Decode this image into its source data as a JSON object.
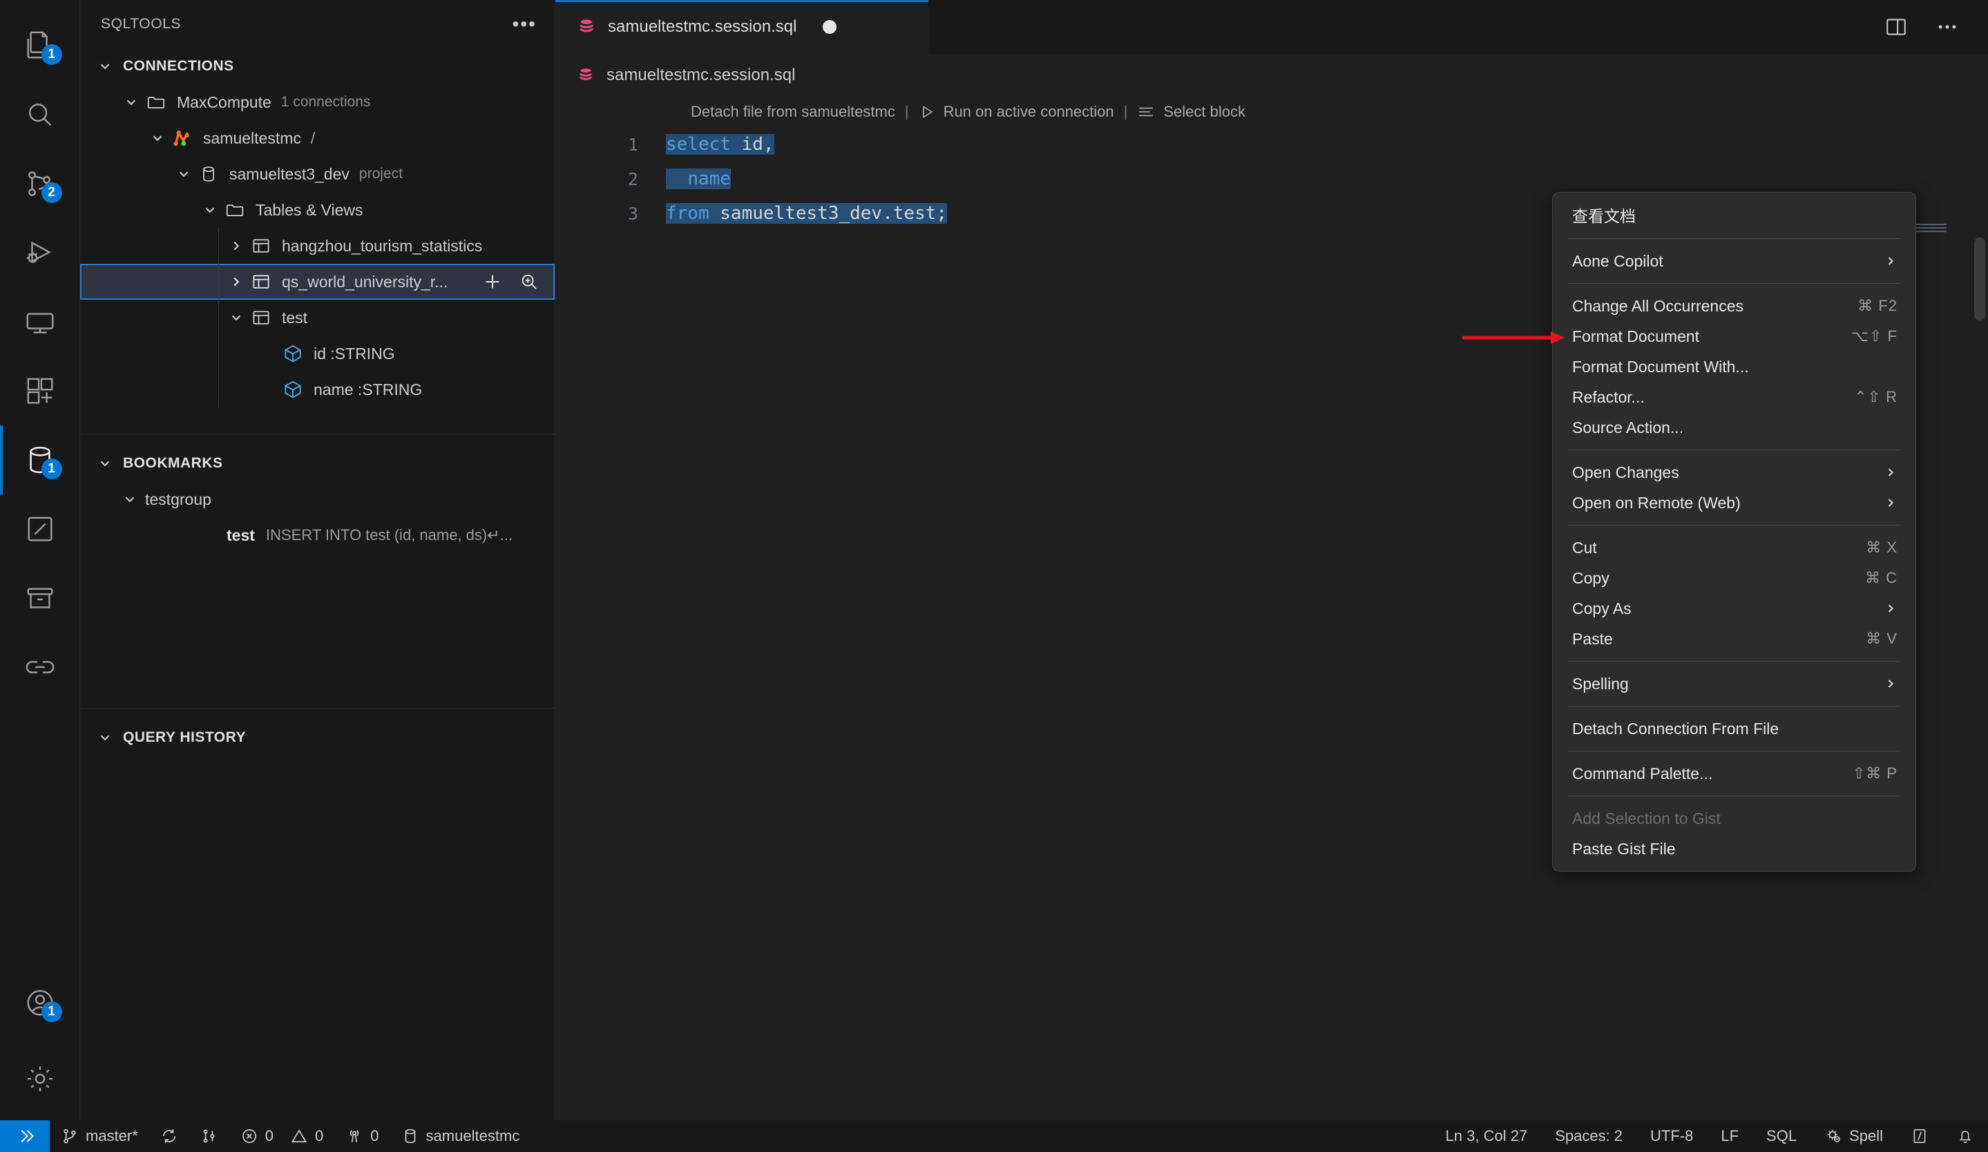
{
  "activitybar": {
    "items": [
      {
        "name": "explorer",
        "icon": "files-icon",
        "badge": "1",
        "active": false
      },
      {
        "name": "search",
        "icon": "search-icon",
        "badge": "",
        "active": false
      },
      {
        "name": "source-control",
        "icon": "source-control-icon",
        "badge": "2",
        "active": false
      },
      {
        "name": "run-and-debug",
        "icon": "run-debug-icon",
        "badge": "",
        "active": false
      },
      {
        "name": "remote-explorer",
        "icon": "remote-explorer-icon",
        "badge": "",
        "active": false
      },
      {
        "name": "extensions",
        "icon": "extensions-icon",
        "badge": "",
        "active": false
      },
      {
        "name": "sqltools",
        "icon": "database-icon",
        "badge": "1",
        "active": true
      },
      {
        "name": "todo",
        "icon": "pencil-icon",
        "badge": "",
        "active": false
      },
      {
        "name": "archive",
        "icon": "archive-icon",
        "badge": "",
        "active": false
      },
      {
        "name": "link",
        "icon": "link-icon",
        "badge": "",
        "active": false
      }
    ],
    "bottom": [
      {
        "name": "accounts",
        "icon": "account-icon",
        "badge": "1"
      },
      {
        "name": "manage-settings",
        "icon": "gear-icon",
        "badge": ""
      }
    ]
  },
  "sidebar": {
    "title": "SQLTOOLS",
    "more_actions": "•••",
    "sections": [
      {
        "name": "connections",
        "label": "CONNECTIONS",
        "expanded": true
      },
      {
        "name": "bookmarks",
        "label": "BOOKMARKS",
        "expanded": true
      },
      {
        "name": "query-history",
        "label": "QUERY HISTORY",
        "expanded": true
      }
    ],
    "connections_tree": [
      {
        "label": "MaxCompute",
        "sub": "1 connections",
        "icon": "folder-icon",
        "depth": 1,
        "twisty": "down",
        "selected": false
      },
      {
        "label": "samueltestmc",
        "slash": "/",
        "icon": "connection-active-icon",
        "depth": 2,
        "twisty": "down",
        "selected": false
      },
      {
        "label": "samueltest3_dev",
        "sub": "project",
        "icon": "database-icon",
        "depth": 3,
        "twisty": "down",
        "selected": false
      },
      {
        "label": "Tables & Views",
        "icon": "folder-icon",
        "depth": 4,
        "twisty": "down",
        "selected": false
      },
      {
        "label": "hangzhou_tourism_statistics",
        "icon": "table-icon",
        "depth": 5,
        "twisty": "right",
        "selected": false
      },
      {
        "label": "qs_world_university_r...",
        "icon": "table-icon",
        "depth": 5,
        "twisty": "right",
        "selected": true,
        "actions": [
          "add-icon",
          "zoom-in-icon"
        ]
      },
      {
        "label": "test",
        "icon": "table-icon",
        "depth": 5,
        "twisty": "down",
        "selected": false
      },
      {
        "label": "id :STRING",
        "icon": "column-icon",
        "depth": 6,
        "twisty": "none",
        "selected": false
      },
      {
        "label": "name :STRING",
        "icon": "column-icon",
        "depth": 6,
        "twisty": "none",
        "selected": false
      }
    ],
    "bookmarks_tree": [
      {
        "label": "testgroup",
        "depth": 1,
        "twisty": "down"
      }
    ],
    "bookmark_item": {
      "name": "test",
      "desc": "INSERT INTO test (id, name, ds)↵..."
    }
  },
  "editor": {
    "tab": {
      "label": "samueltestmc.session.sql",
      "icon": "sql-file-icon",
      "dirty": true
    },
    "tab_actions": [
      "split-editor-icon",
      "more-actions-icon"
    ],
    "breadcrumb": {
      "icon": "sql-file-icon",
      "label": "samueltestmc.session.sql"
    },
    "codelens": {
      "detach": "Detach file from samueltestmc",
      "separator": "|",
      "run": "Run on active connection",
      "select_block": "Select block"
    },
    "lines": [
      {
        "num": "1",
        "text": "select id,"
      },
      {
        "num": "2",
        "text": "  name"
      },
      {
        "num": "3",
        "text": "from samueltest3_dev.test;"
      }
    ]
  },
  "context_menu": {
    "groups": [
      [
        {
          "label": "查看文档",
          "key": "",
          "submenu": false,
          "disabled": false
        }
      ],
      [
        {
          "label": "Aone Copilot",
          "key": "",
          "submenu": true,
          "disabled": false
        }
      ],
      [
        {
          "label": "Change All Occurrences",
          "key": "⌘ F2",
          "submenu": false,
          "disabled": false
        },
        {
          "label": "Format Document",
          "key": "⌥⇧ F",
          "submenu": false,
          "disabled": false
        },
        {
          "label": "Format Document With...",
          "key": "",
          "submenu": false,
          "disabled": false
        },
        {
          "label": "Refactor...",
          "key": "⌃⇧ R",
          "submenu": false,
          "disabled": false
        },
        {
          "label": "Source Action...",
          "key": "",
          "submenu": false,
          "disabled": false
        }
      ],
      [
        {
          "label": "Open Changes",
          "key": "",
          "submenu": true,
          "disabled": false
        },
        {
          "label": "Open on Remote (Web)",
          "key": "",
          "submenu": true,
          "disabled": false
        }
      ],
      [
        {
          "label": "Cut",
          "key": "⌘ X",
          "submenu": false,
          "disabled": false
        },
        {
          "label": "Copy",
          "key": "⌘ C",
          "submenu": false,
          "disabled": false
        },
        {
          "label": "Copy As",
          "key": "",
          "submenu": true,
          "disabled": false
        },
        {
          "label": "Paste",
          "key": "⌘ V",
          "submenu": false,
          "disabled": false
        }
      ],
      [
        {
          "label": "Spelling",
          "key": "",
          "submenu": true,
          "disabled": false
        }
      ],
      [
        {
          "label": "Detach Connection From File",
          "key": "",
          "submenu": false,
          "disabled": false
        }
      ],
      [
        {
          "label": "Command Palette...",
          "key": "⇧⌘ P",
          "submenu": false,
          "disabled": false
        }
      ],
      [
        {
          "label": "Add Selection to Gist",
          "key": "",
          "submenu": false,
          "disabled": true
        },
        {
          "label": "Paste Gist File",
          "key": "",
          "submenu": false,
          "disabled": false
        }
      ]
    ]
  },
  "statusbar": {
    "left": [
      {
        "name": "remote-indicator",
        "icon": "remote-icon",
        "label": ""
      },
      {
        "name": "branch",
        "icon": "branch-icon",
        "label": "master*"
      },
      {
        "name": "sync",
        "icon": "sync-icon",
        "label": ""
      },
      {
        "name": "branch-compare",
        "icon": "branch-compare-icon",
        "label": ""
      },
      {
        "name": "errors",
        "icon": "error-icon",
        "label": "0"
      },
      {
        "name": "warnings",
        "icon": "warning-icon",
        "label": "0"
      },
      {
        "name": "ports",
        "icon": "radio-tower-icon",
        "label": "0"
      },
      {
        "name": "sqltools-connection",
        "icon": "database-icon",
        "label": "samueltestmc"
      }
    ],
    "right": [
      {
        "name": "cursor-position",
        "icon": "",
        "label": "Ln 3, Col 27"
      },
      {
        "name": "indentation",
        "icon": "",
        "label": "Spaces: 2"
      },
      {
        "name": "encoding",
        "icon": "",
        "label": "UTF-8"
      },
      {
        "name": "eol",
        "icon": "",
        "label": "LF"
      },
      {
        "name": "language-mode",
        "icon": "",
        "label": "SQL"
      },
      {
        "name": "spell-checker",
        "icon": "spell-icon",
        "label": "Spell"
      },
      {
        "name": "editor-actions",
        "icon": "slash-box-icon",
        "label": ""
      },
      {
        "name": "notifications",
        "icon": "bell-icon",
        "label": ""
      }
    ]
  },
  "colors": {
    "accent": "#0078d4",
    "selection": "#264f78",
    "tree_selected_bg": "#2f3540",
    "tree_selected_border": "#2f7ad1",
    "arrow_red": "#e81123",
    "connection_orange": "#f27121",
    "connection_green": "#3fdd3f"
  }
}
